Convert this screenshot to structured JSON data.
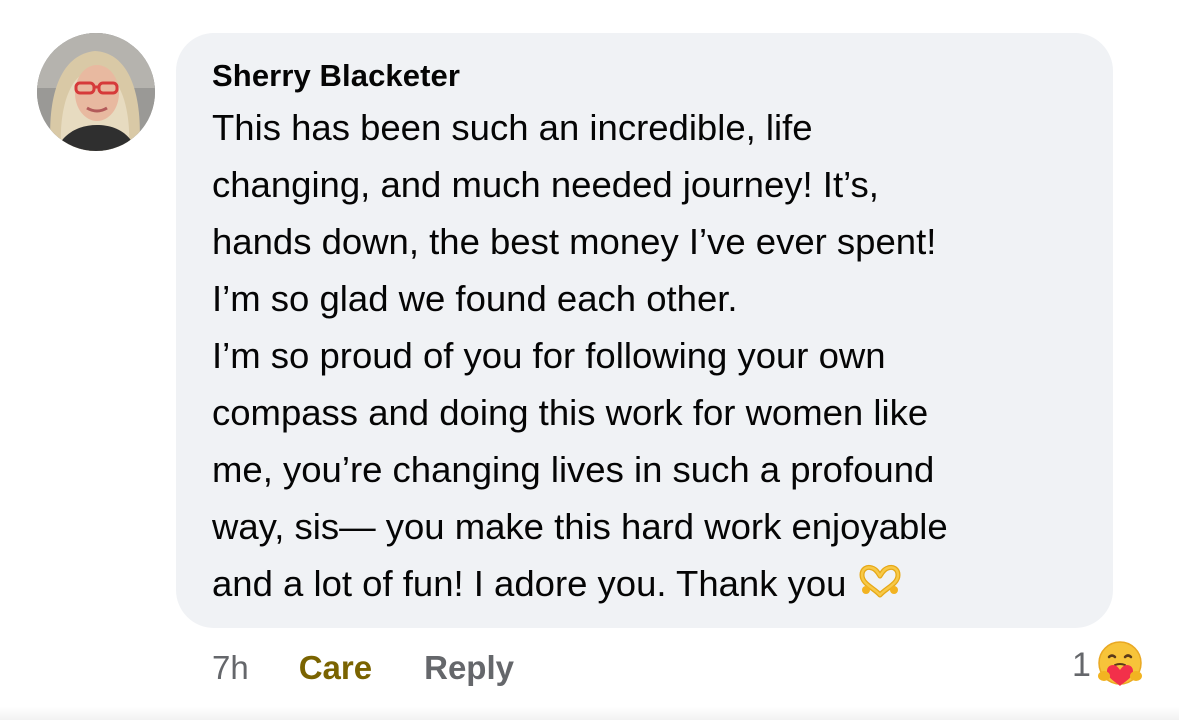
{
  "comment": {
    "author": "Sherry Blacketer",
    "lines": [
      "This has been such an incredible, life",
      "changing, and much needed journey! It’s,",
      "hands down, the best money I’ve ever spent!",
      "I’m so glad we found each other.",
      "I’m so proud of you for following your own",
      "compass and doing this work for women like",
      "me, you’re changing lives in such a profound",
      "way, sis— you make this hard work enjoyable",
      "and a lot of fun! I adore you. Thank you"
    ],
    "emoji": "heart-hands-icon"
  },
  "actions": {
    "time": "7h",
    "reaction_label": "Care",
    "reply_label": "Reply"
  },
  "reactions": {
    "count": "1",
    "icon": "care-reaction-icon"
  },
  "colors": {
    "bubble": "#f0f2f5",
    "care": "#7a6300",
    "muted": "#65676b",
    "text": "#050505"
  }
}
